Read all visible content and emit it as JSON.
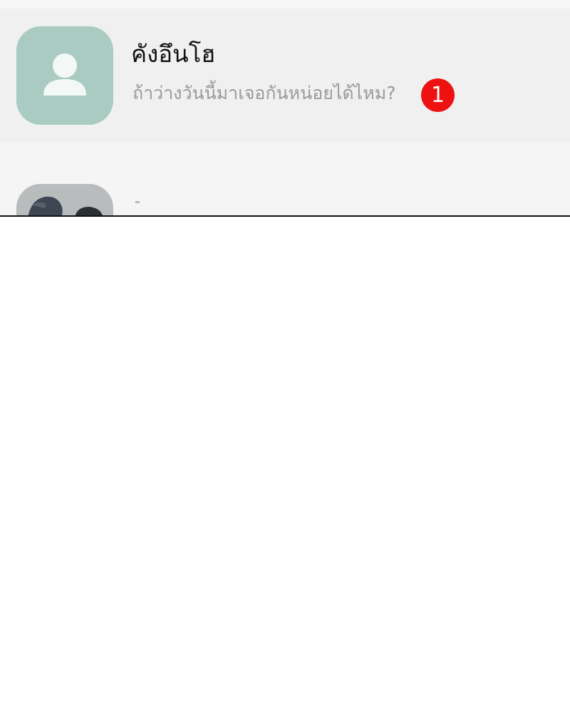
{
  "chat_list": {
    "items": [
      {
        "name": "คังอึนโฮ",
        "preview": "ถ้าว่างวันนี้มาเจอกันหน่อยได้ไหม?",
        "unread": "1",
        "avatar_icon": "default-person-icon",
        "avatar_color": "#a9cbc1"
      },
      {
        "avatar_icon": "photo-avatar"
      }
    ]
  },
  "colors": {
    "badge": "#ee1111",
    "active_row": "#f0f0f0",
    "row": "#f5f5f5",
    "name_text": "#111111",
    "preview_text": "#9a9a9a"
  }
}
